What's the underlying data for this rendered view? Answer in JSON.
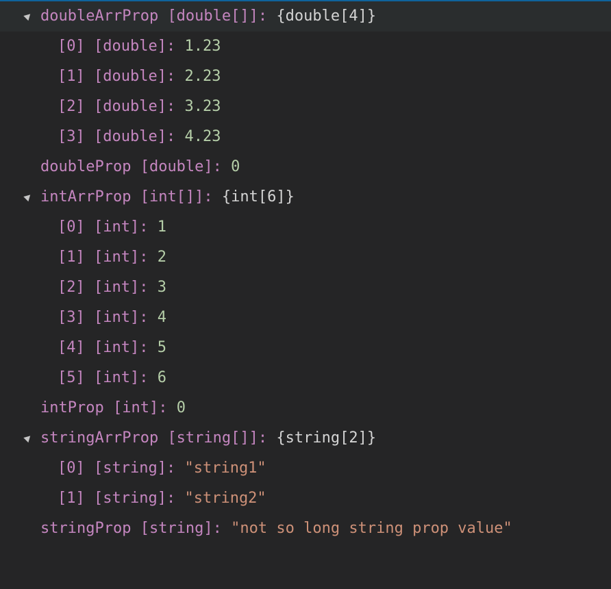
{
  "colors": {
    "background": "#252526",
    "name": "#c586c0",
    "number": "#b5cea8",
    "string": "#ce9178",
    "object_preview": "#d4d4d4"
  },
  "tree": [
    {
      "name": "doubleArrProp",
      "type": "[double[]]",
      "sep": ":",
      "value": "{double[4]}",
      "kind": "obj",
      "expanded": true,
      "level": 0
    },
    {
      "name": "[0]",
      "type": "[double]",
      "sep": ":",
      "value": "1.23",
      "kind": "num",
      "level": 1
    },
    {
      "name": "[1]",
      "type": "[double]",
      "sep": ":",
      "value": "2.23",
      "kind": "num",
      "level": 1
    },
    {
      "name": "[2]",
      "type": "[double]",
      "sep": ":",
      "value": "3.23",
      "kind": "num",
      "level": 1
    },
    {
      "name": "[3]",
      "type": "[double]",
      "sep": ":",
      "value": "4.23",
      "kind": "num",
      "level": 1
    },
    {
      "name": "doubleProp",
      "type": "[double]",
      "sep": ":",
      "value": "0",
      "kind": "num",
      "level": 0
    },
    {
      "name": "intArrProp",
      "type": "[int[]]",
      "sep": ":",
      "value": "{int[6]}",
      "kind": "obj",
      "expanded": true,
      "level": 0
    },
    {
      "name": "[0]",
      "type": "[int]",
      "sep": ":",
      "value": "1",
      "kind": "num",
      "level": 1
    },
    {
      "name": "[1]",
      "type": "[int]",
      "sep": ":",
      "value": "2",
      "kind": "num",
      "level": 1
    },
    {
      "name": "[2]",
      "type": "[int]",
      "sep": ":",
      "value": "3",
      "kind": "num",
      "level": 1
    },
    {
      "name": "[3]",
      "type": "[int]",
      "sep": ":",
      "value": "4",
      "kind": "num",
      "level": 1
    },
    {
      "name": "[4]",
      "type": "[int]",
      "sep": ":",
      "value": "5",
      "kind": "num",
      "level": 1
    },
    {
      "name": "[5]",
      "type": "[int]",
      "sep": ":",
      "value": "6",
      "kind": "num",
      "level": 1
    },
    {
      "name": "intProp",
      "type": "[int]",
      "sep": ":",
      "value": "0",
      "kind": "num",
      "level": 0
    },
    {
      "name": "stringArrProp",
      "type": "[string[]]",
      "sep": ":",
      "value": "{string[2]}",
      "kind": "obj",
      "expanded": true,
      "level": 0
    },
    {
      "name": "[0]",
      "type": "[string]",
      "sep": ":",
      "value": "\"string1\"",
      "kind": "str",
      "level": 1
    },
    {
      "name": "[1]",
      "type": "[string]",
      "sep": ":",
      "value": "\"string2\"",
      "kind": "str",
      "level": 1
    },
    {
      "name": "stringProp",
      "type": "[string]",
      "sep": ":",
      "value": "\"not so long string prop value\"",
      "kind": "str",
      "level": 0
    }
  ]
}
